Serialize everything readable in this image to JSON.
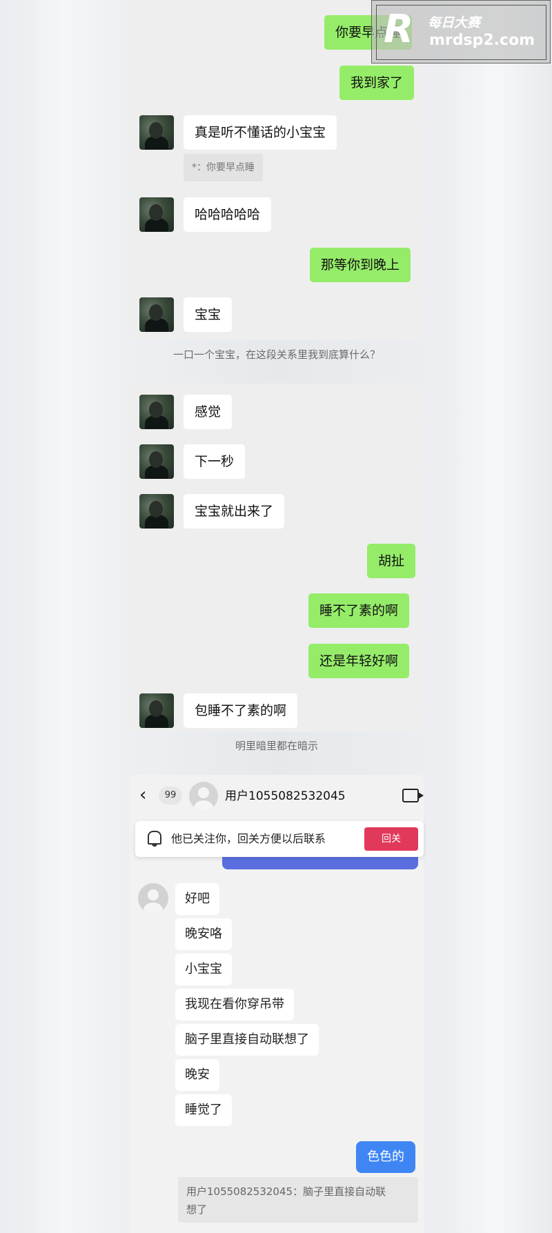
{
  "watermark": {
    "logo_letter": "R",
    "site_name": "每日大赛",
    "url": "mrdsp2.com"
  },
  "screenshot1": {
    "messages": [
      {
        "side": "out",
        "text": "你要早点睡"
      },
      {
        "side": "out",
        "text": "我到家了"
      },
      {
        "side": "in",
        "text": "真是听不懂话的小宝宝"
      },
      {
        "side": "quote",
        "text": "*：你要早点睡"
      },
      {
        "side": "in",
        "text": "哈哈哈哈哈"
      },
      {
        "side": "out",
        "text": "那等你到晚上"
      },
      {
        "side": "in",
        "text": "宝宝"
      }
    ],
    "caption": "一口一个宝宝，在这段关系里我到底算什么？"
  },
  "screenshot2": {
    "messages": [
      {
        "side": "in",
        "text": "感觉"
      },
      {
        "side": "in",
        "text": "下一秒"
      },
      {
        "side": "in",
        "text": "宝宝就出来了"
      },
      {
        "side": "out",
        "text": "胡扯"
      },
      {
        "side": "out",
        "text": "睡不了素的啊"
      },
      {
        "side": "out",
        "text": "还是年轻好啊"
      },
      {
        "side": "in",
        "text": "包睡不了素的啊"
      }
    ],
    "caption": "明里暗里都在暗示"
  },
  "screenshot3": {
    "header": {
      "back_icon": "chevron-left",
      "unread_count": "99",
      "username": "用户1055082532045",
      "video_icon": "video-camera"
    },
    "notice": {
      "text": "他已关注你，回关方便以后联系",
      "button": "回关"
    },
    "messages": [
      "好吧",
      "晚安咯",
      "小宝宝",
      "我现在看你穿吊带",
      "脑子里直接自动联想了",
      "晚安",
      "睡觉了"
    ],
    "reply": "色色的",
    "quoted_line1": "用户1055082532045：脑子里直接自动联",
    "quoted_line2": "想了",
    "colors": {
      "wechat_green": "#95ec69",
      "blue_bubble": "#3f86f4",
      "follow_red": "#e0395a"
    }
  }
}
